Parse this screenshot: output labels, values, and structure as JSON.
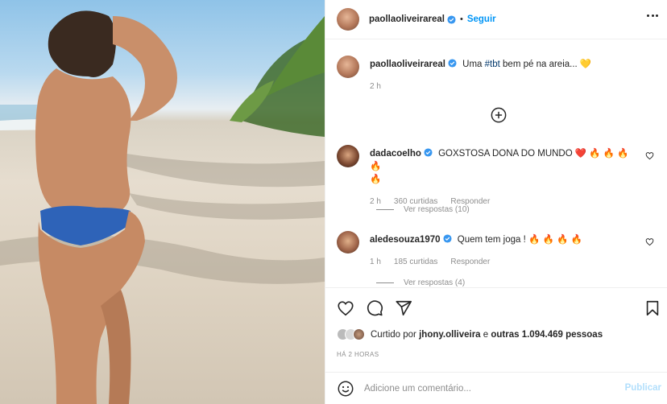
{
  "post": {
    "author": "paollaoliveirareal",
    "follow_label": "Seguir",
    "separator": "•",
    "image_alt": "photo"
  },
  "caption": {
    "username": "paollaoliveirareal",
    "text_before": "Uma ",
    "hashtag": "#tbt",
    "text_after": " bem pé na areia... 💛",
    "time": "2 h"
  },
  "comments": [
    {
      "username": "dadacoelho",
      "text_line1": "GOXSTOSA DONA DO MUNDO ❤️ 🔥 🔥 🔥 🔥",
      "text_line2": "🔥",
      "time": "2 h",
      "likes": "360 curtidas",
      "reply": "Responder",
      "view_replies": "Ver respostas (10)"
    },
    {
      "username": "aledesouza1970",
      "text_line1": "Quem tem joga ! 🔥 🔥 🔥 🔥",
      "time": "1 h",
      "likes": "185 curtidas",
      "reply": "Responder",
      "view_replies": "Ver respostas (4)"
    }
  ],
  "likes_summary": {
    "prefix": "Curtido por ",
    "user": "jhony.olliveira",
    "middle": " e ",
    "others": "outras 1.094.469 pessoas"
  },
  "time_ago": "HÁ 2 HORAS",
  "composer": {
    "placeholder": "Adicione um comentário...",
    "publish_label": "Publicar"
  },
  "colors": {
    "accent": "#0095f6",
    "publish_disabled": "#b2dffc",
    "muted": "#8e8e8e",
    "text": "#262626"
  },
  "icons": [
    "verified-icon",
    "more-options-icon",
    "add-circle-icon",
    "heart-icon",
    "comment-icon",
    "share-icon",
    "bookmark-icon",
    "emoji-icon"
  ]
}
